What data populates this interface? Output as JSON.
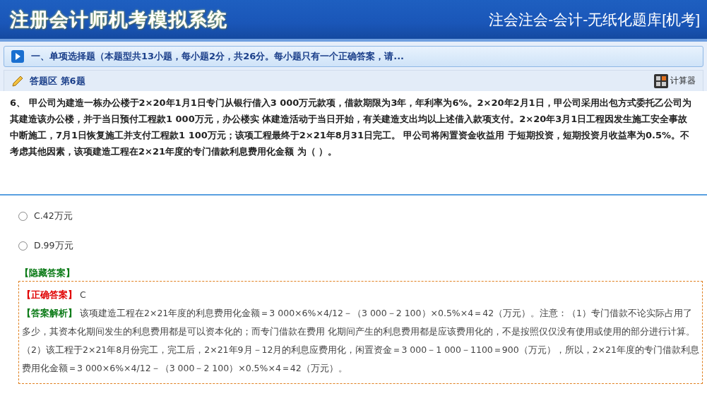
{
  "header": {
    "title": "注册会计师机考模拟系统",
    "subtitle": "注会注会-会计-无纸化题库[机考]"
  },
  "section": {
    "title": "一、单项选择题（本题型共13小题，每小题2分，共26分。每小题只有一个正确答案，请..."
  },
  "answer_area": {
    "title": "答题区 第6题",
    "calculator": "计算器"
  },
  "question": {
    "text": "6、 甲公司为建造一栋办公楼于2×20年1月1日专门从银行借入3 000万元款项，借款期限为3年，年利率为6%。2×20年2月1日，甲公司采用出包方式委托乙公司为其建造该办公楼，并于当日预付工程款1 000万元，办公楼实 体建造活动于当日开始，有关建造支出均以上述借入款项支付。2×20年3月1日工程因发生施工安全事故中断施工，7月1日恢复施工并支付工程款1 100万元；该项工程最终于2×21年8月31日完工。 甲公司将闲置资金收益用 于短期投资，短期投资月收益率为0.5%。不考虑其他因素，该项建造工程在2×21年度的专门借款利息费用化金额 为（  ）。"
  },
  "options": [
    {
      "label": "C.42万元",
      "selected": false
    },
    {
      "label": "D.99万元",
      "selected": false
    }
  ],
  "hide_answer": "【隐藏答案】",
  "answer": {
    "correct_label": "【正确答案】",
    "correct_value": "C",
    "analysis_label": "【答案解析】",
    "analysis": "该项建造工程在2×21年度的利息费用化金额＝3 000×6%×4/12－（3 000－2 100）×0.5%×4＝42（万元）。注意：（1）专门借款不论实际占用了多少，其资本化期间发生的利息费用都是可以资本化的；而专门借款在费用 化期间产生的利息费用都是应该费用化的，不是按照仅仅没有使用或使用的部分进行计算。（2）该工程于2×21年8月份完工，完工后，2×21年9月－12月的利息应费用化，闲置资金＝3 000－1 000－1100＝900（万元），所以，2×21年度的专门借款利息费用化金额＝3 000×6%×4/12－（3 000－2 100）×0.5%×4＝42（万元）。"
  }
}
